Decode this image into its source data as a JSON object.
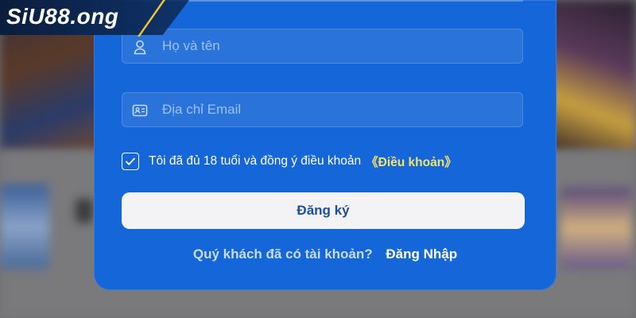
{
  "brand": {
    "logo_text": "SiU88.ong"
  },
  "form": {
    "name_field": {
      "placeholder": "Họ và tên",
      "value": ""
    },
    "email_field": {
      "placeholder": "Địa chỉ Email",
      "value": ""
    },
    "agreement": {
      "checked": true,
      "text": "Tôi đã đủ 18 tuổi và đồng ý điều khoản",
      "terms_link": "《Điều khoản》"
    },
    "register_label": "Đăng ký",
    "login_prompt": "Quý khách đã có tài khoản?",
    "login_link": "Đăng Nhập"
  },
  "colors": {
    "panel": "#1566d8",
    "terms_link": "#f4e36a",
    "button_bg": "#f3f3f5",
    "button_text": "#1c4f9c",
    "logo_accent": "#f1c233"
  }
}
